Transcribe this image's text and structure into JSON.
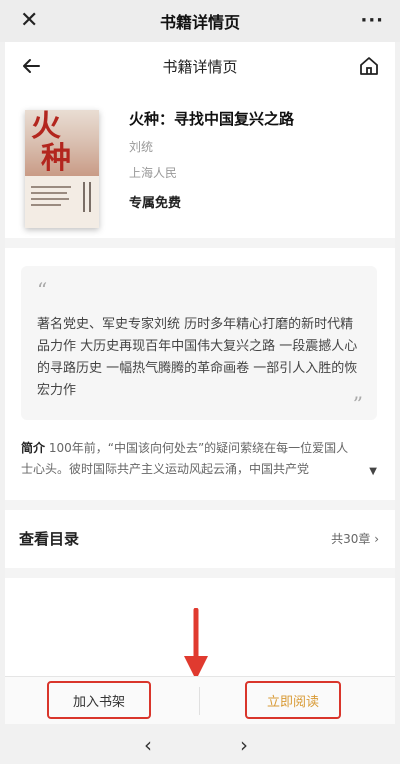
{
  "wechat": {
    "title": "书籍详情页",
    "close_glyph": "✕",
    "more_glyph": "···"
  },
  "nav": {
    "title": "书籍详情页"
  },
  "book": {
    "title": "火种：寻找中国复兴之路",
    "author": "刘统",
    "publisher": "上海人民",
    "badge": "专属免费",
    "cover_big_chars": [
      "火",
      "种"
    ]
  },
  "quote": {
    "open_mark": "“",
    "text": "著名党史、军史专家刘统 历时多年精心打磨的新时代精品力作 大历史再现百年中国伟大复兴之路 一段震撼人心的寻路历史 一幅热气腾腾的革命画卷 一部引人入胜的恢宏力作",
    "close_mark": "”"
  },
  "intro": {
    "label": "简介",
    "text": "100年前，“中国该向何处去”的疑问萦绕在每一位爱国人士心头。彼时国际共产主义运动风起云涌，中国共产党",
    "expand_glyph": "▼"
  },
  "toc": {
    "label": "查看目录",
    "count": "共30章 ›"
  },
  "bottom": {
    "add_shelf": "加入书架",
    "read_now": "立即阅读"
  },
  "browser": {
    "back": "‹",
    "forward": "›"
  },
  "colors": {
    "highlight_red": "#d9352b",
    "read_text": "#d89a35",
    "arrow_red": "#e03a2f"
  }
}
